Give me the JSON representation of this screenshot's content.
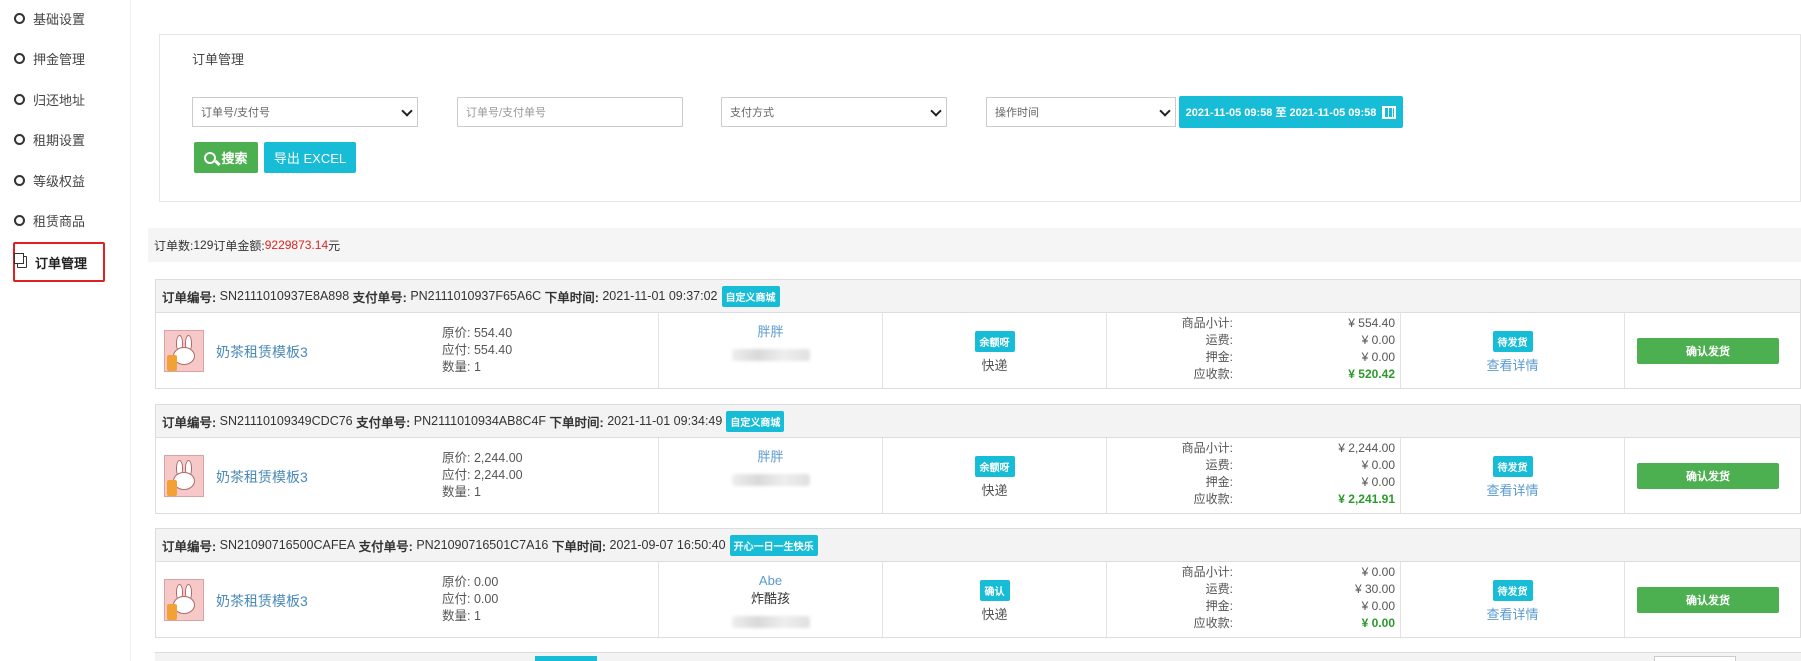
{
  "sidebar": {
    "items": [
      {
        "label": "基础设置",
        "icon": "circle-icon"
      },
      {
        "label": "押金管理",
        "icon": "circle-icon"
      },
      {
        "label": "归还地址",
        "icon": "circle-icon"
      },
      {
        "label": "租期设置",
        "icon": "circle-icon"
      },
      {
        "label": "等级权益",
        "icon": "circle-icon"
      },
      {
        "label": "租赁商品",
        "icon": "circle-icon"
      },
      {
        "label": "订单管理",
        "icon": "document-icon",
        "active": true
      }
    ]
  },
  "filter": {
    "title": "订单管理",
    "order_type_select": "订单号/支付号",
    "order_input_placeholder": "订单号/支付单号",
    "payment_select": "支付方式",
    "time_select": "操作时间",
    "date_range": "2021-11-05 09:58 至 2021-11-05 09:58",
    "search_label": "搜索",
    "export_label": "导出 EXCEL"
  },
  "summary": {
    "count_label": "订单数: ",
    "count": "129",
    "amount_label": " 订单金额: ",
    "amount": "9229873.14",
    "unit": "元"
  },
  "labels": {
    "order_no": "订单编号:",
    "pay_no": "支付单号:",
    "order_time": "下单时间:",
    "orig_price": "原价: ",
    "due_price": "应付: ",
    "qty": "数量: ",
    "subtotal": "商品小计:",
    "shipping": "运费:",
    "deposit": "押金:",
    "receivable": "应收款:",
    "delivery": "快递",
    "detail_link": "查看详情",
    "confirm_button": "确认发货"
  },
  "orders": [
    {
      "order_no": "SN2111010937E8A898",
      "pay_no": "PN2111010937F65A6C",
      "time": "2021-11-01 09:37:02",
      "shop_tag": "自定义商城",
      "product": "奶茶租赁模板3",
      "orig_price": "554.40",
      "due_price": "554.40",
      "qty": "1",
      "buyer_line1": "胖胖",
      "buyer_line2": "",
      "pay_method": "余额呀",
      "subtotal": "¥ 554.40",
      "shipping": "¥ 0.00",
      "deposit": "¥ 0.00",
      "receivable": "¥ 520.42",
      "status": "待发货"
    },
    {
      "order_no": "SN21110109349CDC76",
      "pay_no": "PN2111010934AB8C4F",
      "time": "2021-11-01 09:34:49",
      "shop_tag": "自定义商城",
      "product": "奶茶租赁模板3",
      "orig_price": "2,244.00",
      "due_price": "2,244.00",
      "qty": "1",
      "buyer_line1": "胖胖",
      "buyer_line2": "",
      "pay_method": "余额呀",
      "subtotal": "¥ 2,244.00",
      "shipping": "¥ 0.00",
      "deposit": "¥ 0.00",
      "receivable": "¥ 2,241.91",
      "status": "待发货"
    },
    {
      "order_no": "SN21090716500CAFEA",
      "pay_no": "PN21090716501C7A16",
      "time": "2021-09-07 16:50:40",
      "shop_tag": "开心一日一生快乐",
      "product": "奶茶租赁模板3",
      "orig_price": "0.00",
      "due_price": "0.00",
      "qty": "1",
      "buyer_line1": "Abe",
      "buyer_line2": "炸酷孩",
      "pay_method": "确认",
      "subtotal": "¥ 0.00",
      "shipping": "¥ 30.00",
      "deposit": "¥ 0.00",
      "receivable": "¥ 0.00",
      "status": "待发货"
    }
  ]
}
